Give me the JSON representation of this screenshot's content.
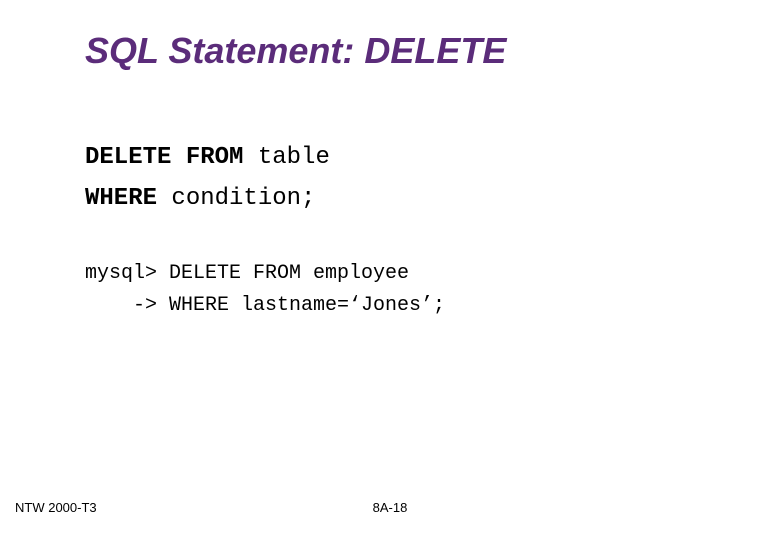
{
  "slide": {
    "title": "SQL Statement: DELETE"
  },
  "syntax": {
    "line1_keyword": "DELETE FROM ",
    "line1_param": "table",
    "line2_keyword": "WHERE ",
    "line2_param": "condition;"
  },
  "example": {
    "line1": "mysql> DELETE FROM employee",
    "line2": "-> WHERE lastname=‘Jones’;"
  },
  "footer": {
    "left": "NTW 2000-T3",
    "center": "8A-18"
  }
}
